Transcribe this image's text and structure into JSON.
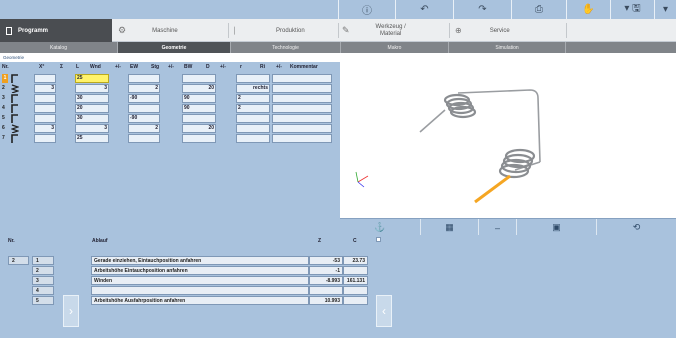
{
  "quick_bar": {
    "icons": [
      "info-icon",
      "undo-icon",
      "redo-icon",
      "print-icon",
      "hand-icon",
      "save-icon",
      "dropdown-icon"
    ],
    "info_glyph": "ⓘ",
    "undo_glyph": "↶",
    "redo_glyph": "↷",
    "print_glyph": "⎙",
    "hand_glyph": "✋",
    "save_glyph": "▾ 🖫",
    "dropdown_glyph": "▾"
  },
  "modules": {
    "programm": "Programm",
    "maschine": "Maschine",
    "produktion": "Produktion",
    "werkzeug": "Werkzeug /\nMaterial",
    "service": "Service"
  },
  "tabs": [
    "Katalog",
    "Geometrie",
    "Technologie",
    "Makro",
    "Simulation"
  ],
  "active_tab": "Geometrie",
  "geometry": {
    "section_label": "Geometrie",
    "headers": [
      "Nr.",
      "X°",
      "Σ",
      "L",
      "Wnd",
      "+/-",
      "EW",
      "Stg",
      "+/-",
      "BW",
      "D",
      "+/-",
      "r",
      "Ri",
      "+/-",
      "Kommentar"
    ],
    "rows": [
      {
        "nr": "1",
        "icon": "line-icon",
        "x": "",
        "l": "25",
        "wnd": "",
        "ew": "",
        "stg": "",
        "bw": "",
        "d": "",
        "r": "",
        "ri": "",
        "highlight": true
      },
      {
        "nr": "2",
        "icon": "coil-icon",
        "x": "3",
        "l": "",
        "wnd": "3",
        "ew": "",
        "stg": "2",
        "bw": "",
        "d": "20",
        "r": "",
        "ri": "rechts"
      },
      {
        "nr": "3",
        "icon": "line-icon",
        "x": "",
        "l": "30",
        "wnd": "",
        "ew": "-90",
        "stg": "",
        "bw": "90",
        "d": "",
        "r": "2",
        "ri": ""
      },
      {
        "nr": "4",
        "icon": "line-icon",
        "x": "",
        "l": "20",
        "wnd": "",
        "ew": "",
        "stg": "",
        "bw": "90",
        "d": "",
        "r": "2",
        "ri": ""
      },
      {
        "nr": "5",
        "icon": "line-icon",
        "x": "",
        "l": "30",
        "wnd": "",
        "ew": "-90",
        "stg": "",
        "bw": "",
        "d": "",
        "r": "",
        "ri": ""
      },
      {
        "nr": "6",
        "icon": "coil-icon",
        "x": "3",
        "l": "",
        "wnd": "3",
        "ew": "",
        "stg": "2",
        "bw": "",
        "d": "20",
        "r": "",
        "ri": ""
      },
      {
        "nr": "7",
        "icon": "line-icon",
        "x": "",
        "l": "25",
        "wnd": "",
        "ew": "",
        "stg": "",
        "bw": "",
        "d": "",
        "r": "",
        "ri": ""
      }
    ]
  },
  "view_toolbar": {
    "icons": [
      "axis-view-icon",
      "machine-view-icon",
      "minus-icon",
      "camera-icon",
      "rotate-view-icon"
    ]
  },
  "sequence": {
    "headers": {
      "nr": "Nr.",
      "ablauf": "Ablauf",
      "z": "Z",
      "c": "C"
    },
    "group_nr": "2",
    "rows": [
      {
        "idx": "1",
        "ablauf": "Gerade einziehen, Eintauchposition anfahren",
        "z": "-53",
        "c": "23.73"
      },
      {
        "idx": "2",
        "ablauf": "Arbeitshöhe Eintauchposition anfahren",
        "z": "-1",
        "c": ""
      },
      {
        "idx": "3",
        "ablauf": "Winden",
        "z": "-8.993",
        "c": "161.131"
      },
      {
        "idx": "4",
        "ablauf": "",
        "z": "",
        "c": ""
      },
      {
        "idx": "5",
        "ablauf": "Arbeitshöhe Ausfahrposition anfahren",
        "z": "10.993",
        "c": ""
      }
    ],
    "next_glyph": "›",
    "prev_glyph": "‹"
  },
  "colors": {
    "panel_blue": "#a9c2dd",
    "highlight_yellow": "#fff36a",
    "selected_orange": "#f0a020",
    "wire_orange": "#f5a623",
    "spring_grey": "#8a8d91"
  }
}
